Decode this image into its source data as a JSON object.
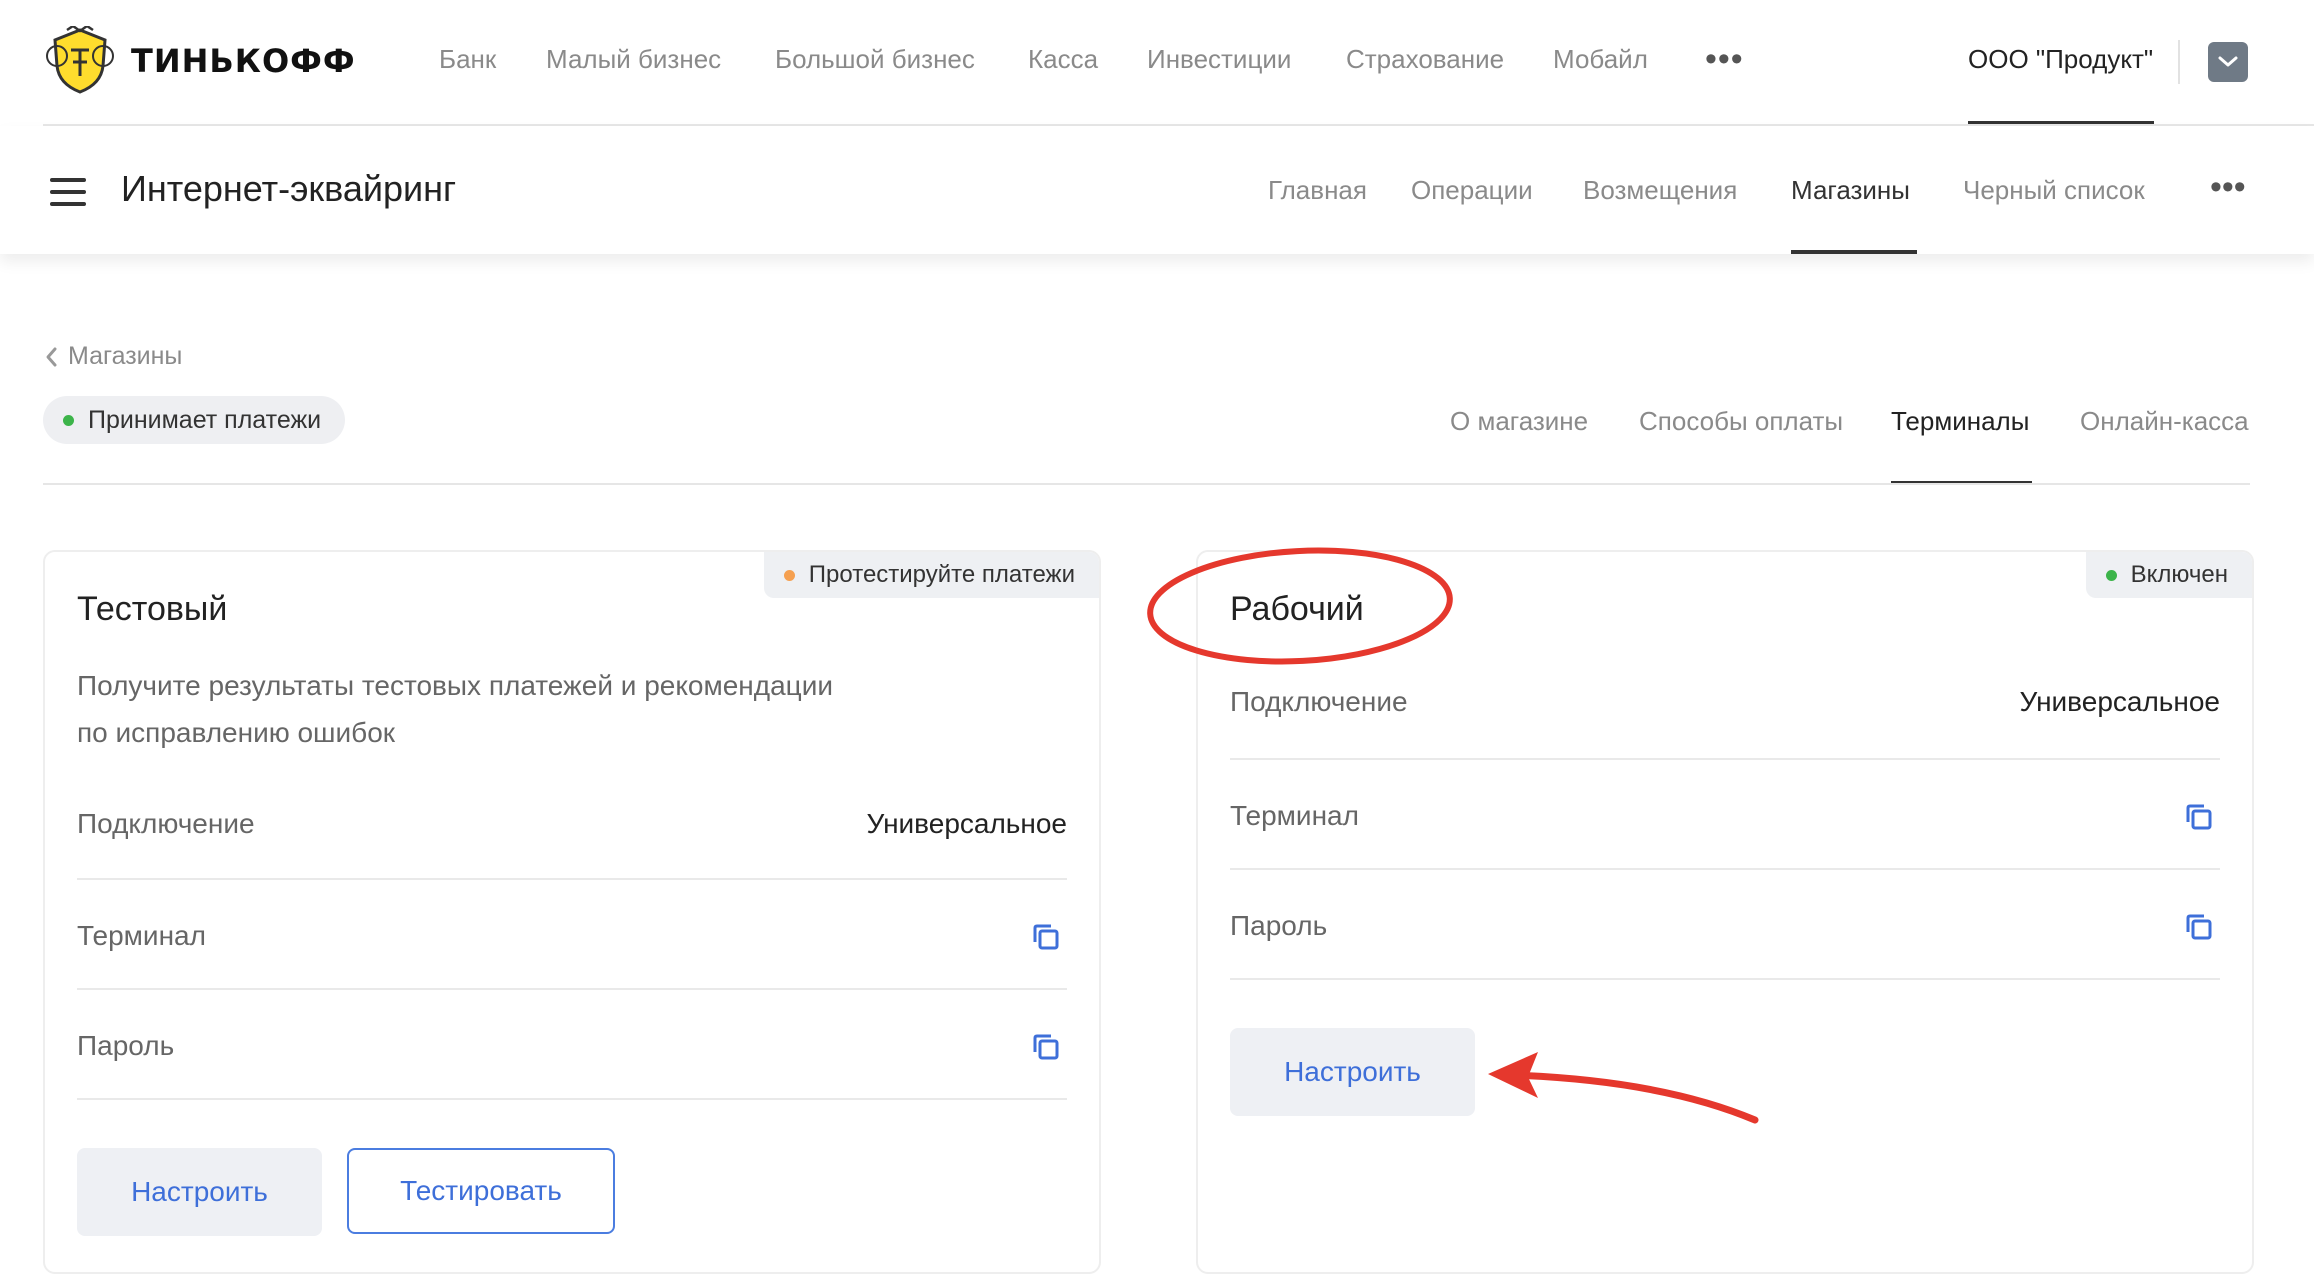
{
  "brand": {
    "name": "ТИНЬКОФФ"
  },
  "topnav": {
    "items": [
      "Банк",
      "Малый бизнес",
      "Большой бизнес",
      "Касса",
      "Инвестиции",
      "Страхование",
      "Мобайл"
    ],
    "more": "•••",
    "company": "ООО \"Продукт\""
  },
  "section": {
    "title": "Интернет-эквайринг",
    "tabs": [
      "Главная",
      "Операции",
      "Возмещения",
      "Магазины",
      "Черный список"
    ],
    "active_tab": "Магазины",
    "more": "•••"
  },
  "store": {
    "back_label": "Магазины",
    "status": "Принимает платежи",
    "tabs": [
      "О магазине",
      "Способы оплаты",
      "Терминалы",
      "Онлайн-касса"
    ],
    "active_tab": "Терминалы"
  },
  "cards": {
    "test": {
      "badge": "Протестируйте платежи",
      "title": "Тестовый",
      "description_line1": "Получите результаты тестовых платежей и рекомендации",
      "description_line2": "по исправлению ошибок",
      "connection_label": "Подключение",
      "connection_value": "Универсальное",
      "terminal_label": "Терминал",
      "password_label": "Пароль",
      "configure_label": "Настроить",
      "test_label": "Тестировать"
    },
    "work": {
      "badge": "Включен",
      "title": "Рабочий",
      "connection_label": "Подключение",
      "connection_value": "Универсальное",
      "terminal_label": "Терминал",
      "password_label": "Пароль",
      "configure_label": "Настроить"
    }
  },
  "colors": {
    "accent_blue": "#3e6fd9",
    "status_green": "#3cb44a",
    "status_orange": "#f5a050",
    "annotation_red": "#e5382d"
  },
  "icons": {
    "copy": "copy-icon",
    "back": "chevron-left-icon",
    "menu": "hamburger-menu-icon",
    "dropdown": "chevron-down-icon"
  }
}
